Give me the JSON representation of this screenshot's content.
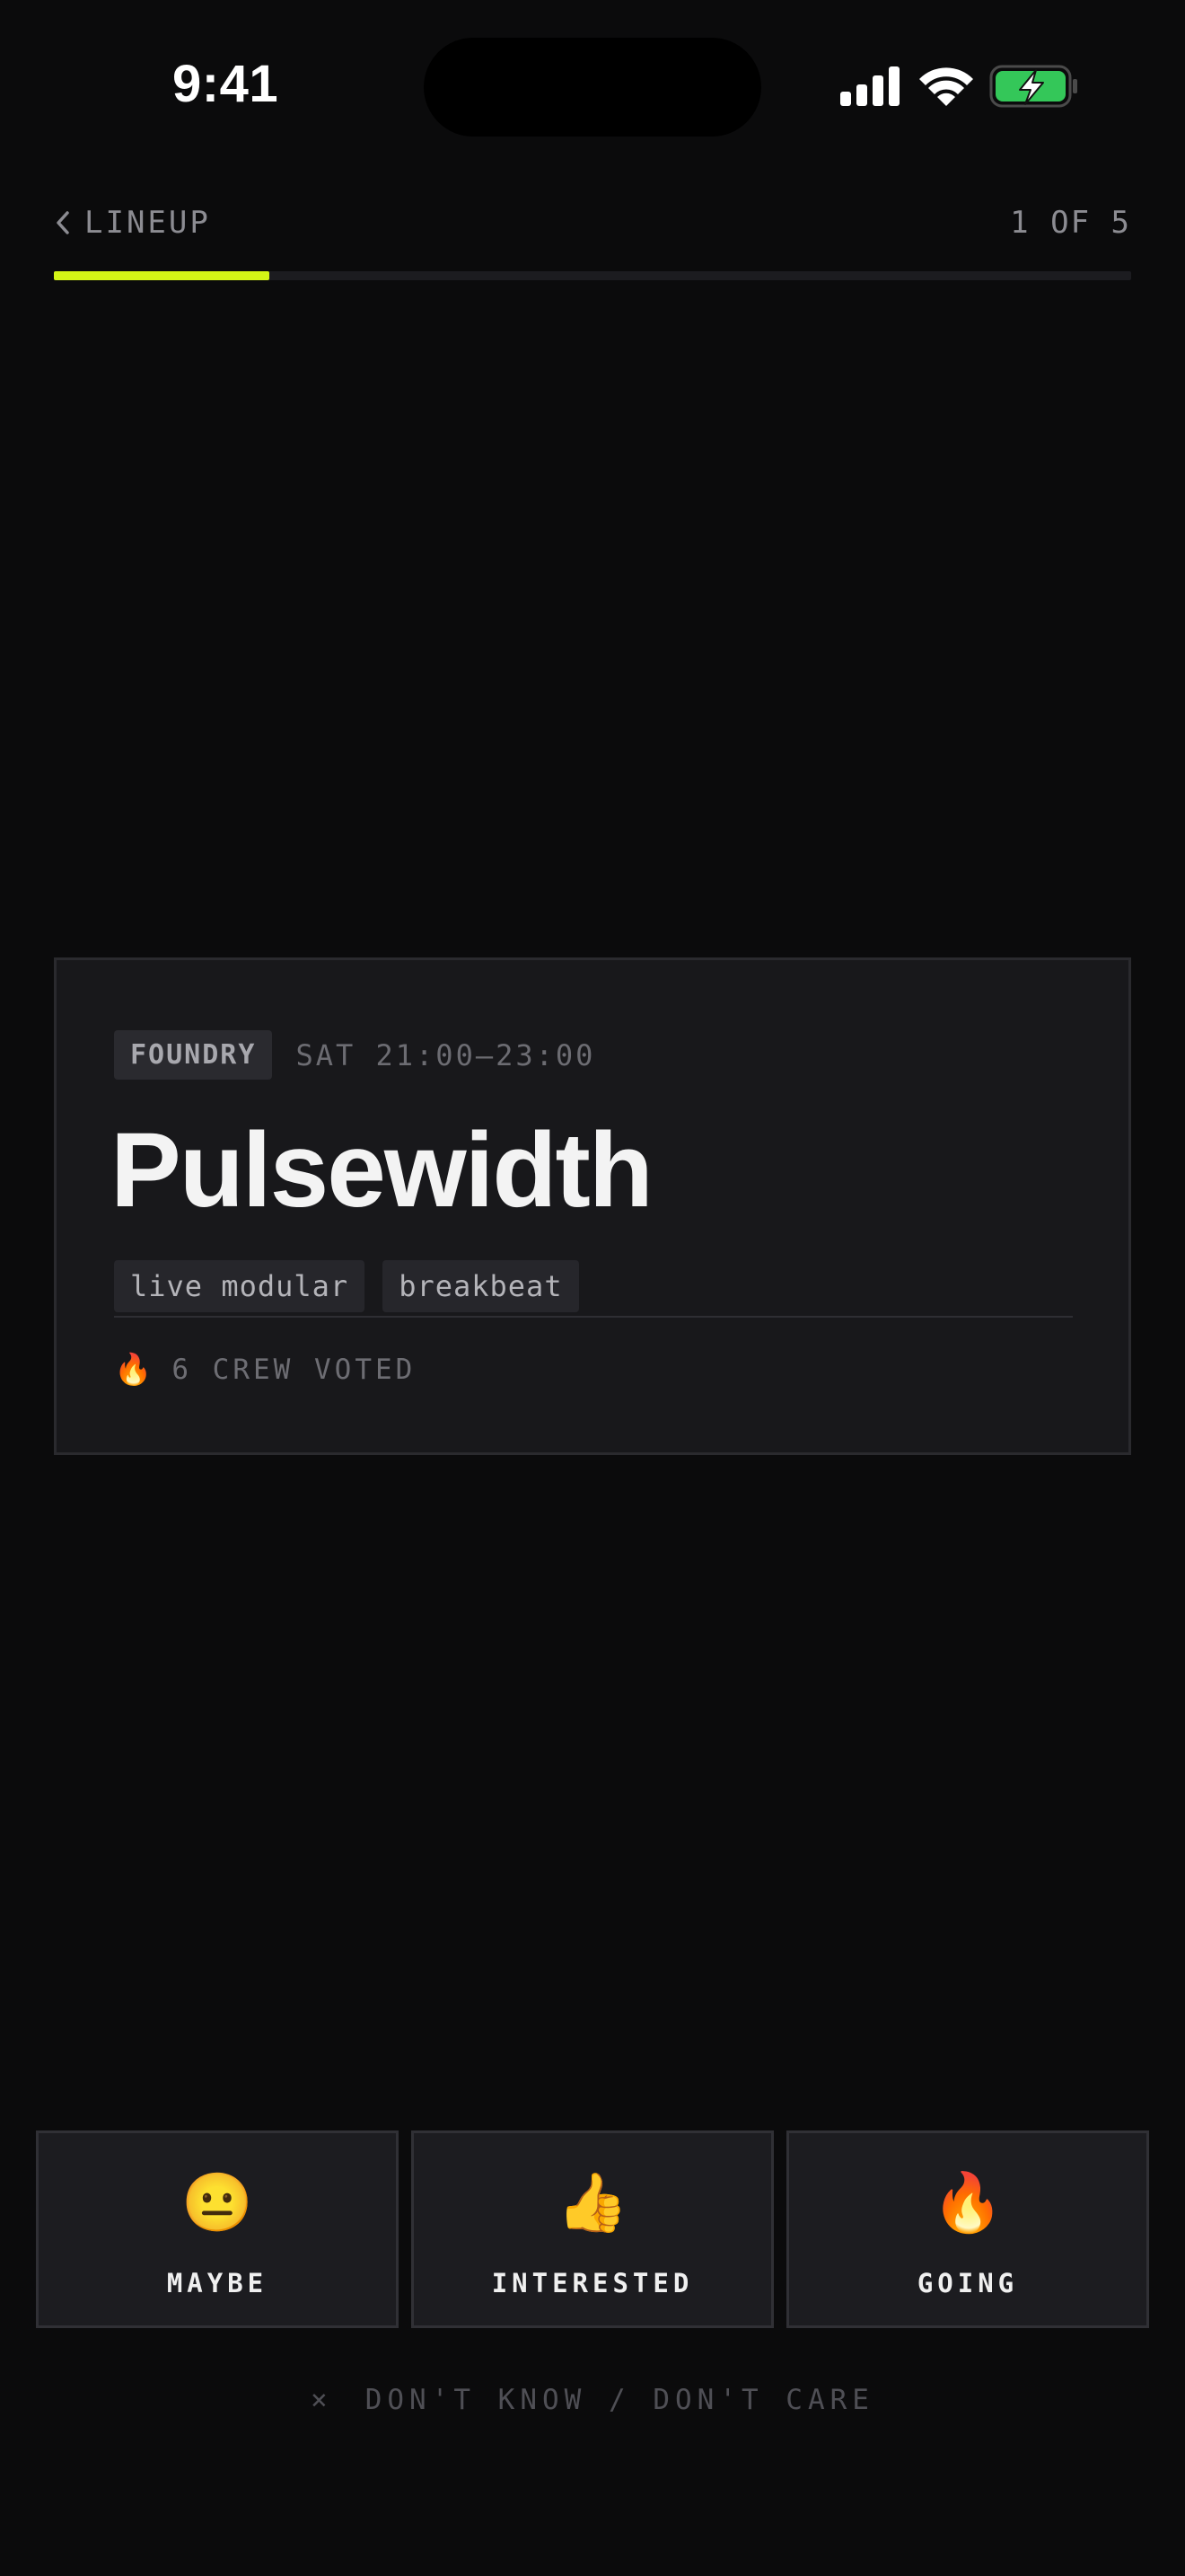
{
  "status_bar": {
    "time": "9:41"
  },
  "header": {
    "back_label": "LINEUP",
    "progress_label": "1 OF 5",
    "progress_current": 1,
    "progress_total": 5,
    "accent_color": "#d4f516"
  },
  "card": {
    "stage": "FOUNDRY",
    "time_slot": "SAT 21:00–23:00",
    "artist": "Pulsewidth",
    "tags": [
      "live modular",
      "breakbeat"
    ],
    "votes_icon": "🔥",
    "votes_text": "6 CREW VOTED"
  },
  "vote_options": [
    {
      "emoji": "😐",
      "label": "MAYBE"
    },
    {
      "emoji": "👍",
      "label": "INTERESTED"
    },
    {
      "emoji": "🔥",
      "label": "GOING"
    }
  ],
  "skip": {
    "icon": "×",
    "label": "DON'T KNOW / DON'T CARE"
  }
}
